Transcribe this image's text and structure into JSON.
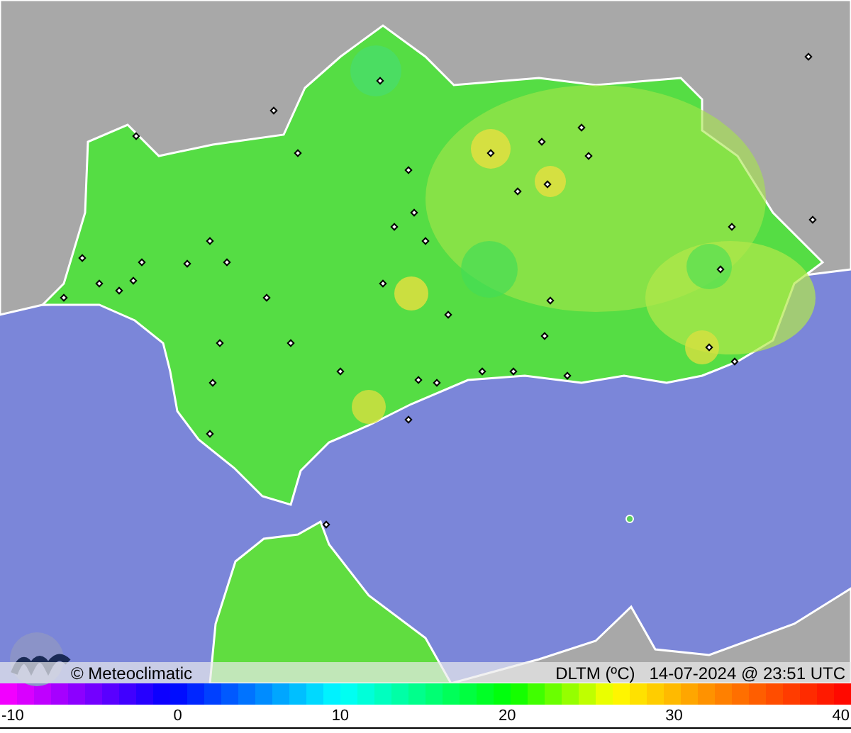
{
  "map": {
    "credit": "© Meteoclimatic",
    "variable": "DLTM (ºC)",
    "timestamp": "14-07-2024 @ 23:51 UTC"
  },
  "legend": {
    "ticks": [
      "-10",
      "0",
      "10",
      "20",
      "30",
      "40"
    ]
  }
}
